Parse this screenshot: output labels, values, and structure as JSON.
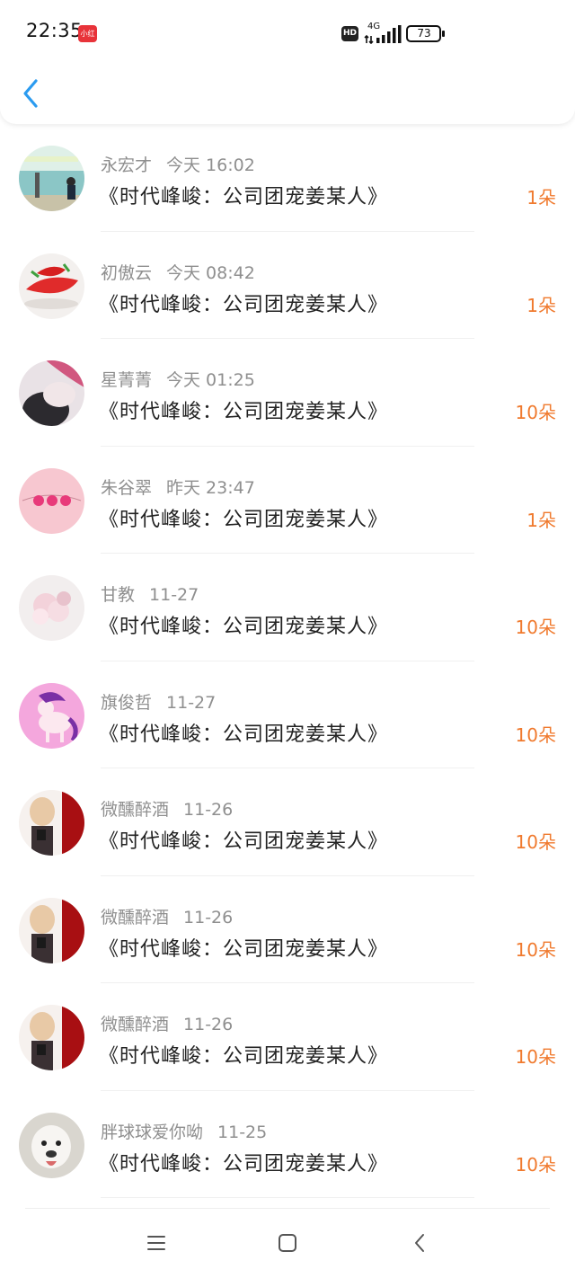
{
  "status_bar": {
    "time": "22:35",
    "app_badge": "小红书",
    "hd": "HD",
    "network": "4G",
    "battery": "73"
  },
  "header": {
    "back_icon": "chevron-left-icon"
  },
  "gifts": [
    {
      "name": "永宏才",
      "time": "今天 16:02",
      "title": "《时代峰峻：公司团宠姜某人》",
      "amount": "1朵"
    },
    {
      "name": "初傲云",
      "time": "今天 08:42",
      "title": "《时代峰峻：公司团宠姜某人》",
      "amount": "1朵"
    },
    {
      "name": "星菁菁",
      "time": "今天 01:25",
      "title": "《时代峰峻：公司团宠姜某人》",
      "amount": "10朵"
    },
    {
      "name": "朱谷翠",
      "time": "昨天 23:47",
      "title": "《时代峰峻：公司团宠姜某人》",
      "amount": "1朵"
    },
    {
      "name": "甘教",
      "time": "11-27",
      "title": "《时代峰峻：公司团宠姜某人》",
      "amount": "10朵"
    },
    {
      "name": "旗俊哲",
      "time": "11-27",
      "title": "《时代峰峻：公司团宠姜某人》",
      "amount": "10朵"
    },
    {
      "name": "微醺醉酒",
      "time": "11-26",
      "title": "《时代峰峻：公司团宠姜某人》",
      "amount": "10朵"
    },
    {
      "name": "微醺醉酒",
      "time": "11-26",
      "title": "《时代峰峻：公司团宠姜某人》",
      "amount": "10朵"
    },
    {
      "name": "微醺醉酒",
      "time": "11-26",
      "title": "《时代峰峻：公司团宠姜某人》",
      "amount": "10朵"
    },
    {
      "name": "胖球球爱你呦",
      "time": "11-25",
      "title": "《时代峰峻：公司团宠姜某人》",
      "amount": "10朵"
    }
  ],
  "colors": {
    "accent_back": "#2b9bf0",
    "amount": "#f07a2e",
    "name_gray": "#8f8f8f",
    "title": "#222222"
  },
  "nav": {
    "menu_icon": "menu-icon",
    "home_icon": "home-square-icon",
    "back_icon": "back-triangle-icon"
  }
}
